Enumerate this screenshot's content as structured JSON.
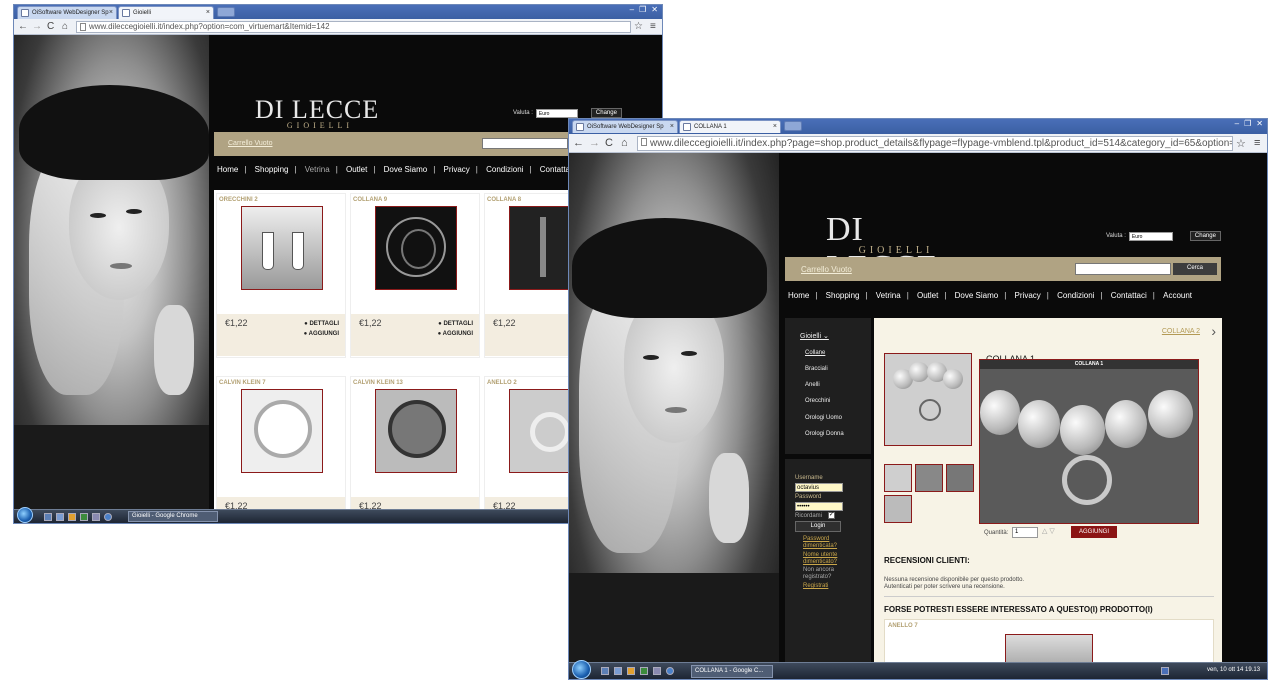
{
  "window1": {
    "tabs": [
      {
        "label": "OiSoftware WebDesigner Sp"
      },
      {
        "label": "Gioielli"
      }
    ],
    "url": "www.dileccegioielli.it/index.php?option=com_virtuemart&Itemid=142",
    "logo": {
      "title": "DI LECCE",
      "subtitle": "GIOIELLI"
    },
    "currency": {
      "label": "Valuta :",
      "value": "Euro",
      "change": "Change"
    },
    "cart": "Carrello Vuoto",
    "menu": [
      "Home",
      "Shopping",
      "Vetrina",
      "Outlet",
      "Dove Siamo",
      "Privacy",
      "Condizioni",
      "Contattaci"
    ],
    "products": [
      {
        "name": "ORECCHINI 2",
        "price": "€1,22",
        "details": "DETTAGLI",
        "add": "AGGIUNGI"
      },
      {
        "name": "COLLANA 9",
        "price": "€1,22",
        "details": "DETTAGLI",
        "add": "AGGIUNGI"
      },
      {
        "name": "COLLANA 8",
        "price": "€1,22"
      },
      {
        "name": "CALVIN KLEIN 7",
        "price": "€1,22"
      },
      {
        "name": "CALVIN KLEIN 13",
        "price": "€1,22"
      },
      {
        "name": "ANELLO 2",
        "price": "€1,22"
      }
    ],
    "taskbar": {
      "task": "Gioielli - Google Chrome"
    }
  },
  "window2": {
    "tabs": [
      {
        "label": "OiSoftware WebDesigner Sp"
      },
      {
        "label": "COLLANA 1"
      }
    ],
    "url": "www.dileccegioielli.it/index.php?page=shop.product_details&flypage=flypage-vmblend.tpl&product_id=514&category_id=65&option=com_virtuem",
    "logo": {
      "title": "DI LECCE",
      "subtitle": "GIOIELLI"
    },
    "currency": {
      "label": "Valuta :",
      "value": "Euro",
      "change": "Change"
    },
    "cart": "Carrello Vuoto",
    "search_button": "Cerca",
    "menu": [
      "Home",
      "Shopping",
      "Vetrina",
      "Outlet",
      "Dove Siamo",
      "Privacy",
      "Condizioni",
      "Contattaci",
      "Account"
    ],
    "categories": {
      "head": "Gioielli",
      "items": [
        "Collane",
        "Bracciali",
        "Anelli",
        "Orecchini",
        "Orologi Uomo",
        "Orologi Donna"
      ]
    },
    "login": {
      "username_label": "Username",
      "username_value": "octavius",
      "password_label": "Password",
      "password_value": "••••••",
      "remember": "Ricordami",
      "button": "Login",
      "links": [
        "Password dimenticata?",
        "Nome utente dimenticato?",
        "Non ancora registrato?",
        "Registrati"
      ]
    },
    "product": {
      "next": "COLLANA 2",
      "title": "COLLANA 1",
      "image_title": "COLLANA 1",
      "qty_label": "Quantità:",
      "qty_value": "1",
      "add": "AGGIUNGI",
      "reviews_title": "RECENSIONI CLIENTI:",
      "reviews_text_1": "Nessuna recensione disponibile per questo prodotto.",
      "reviews_text_2": "Autenticati per poter scrivere una recensione.",
      "related_title": "FORSE POTRESTI ESSERE INTERESSATO A QUESTO(I) PRODOTTO(I)",
      "related_item": "ANELLO 7"
    },
    "taskbar": {
      "task": "COLLANA 1 - Google C...",
      "clock": "ven, 10 ott 14  19.13"
    }
  }
}
